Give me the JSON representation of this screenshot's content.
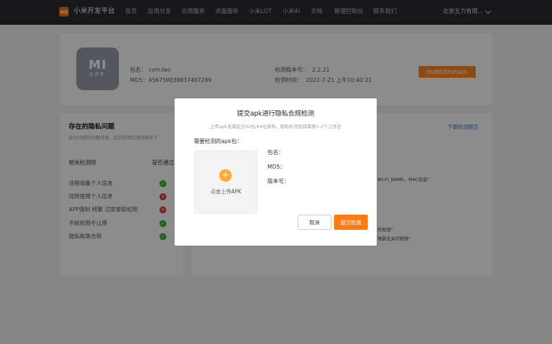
{
  "header": {
    "logo_text": "mi",
    "brand": "小米开发平台",
    "nav": [
      "首页",
      "应用分发",
      "应用服务",
      "流量服务",
      "小米LOT",
      "小米AI",
      "文档",
      "管理控制台",
      "联系我们"
    ],
    "company": "北京五力有限..."
  },
  "app_info": {
    "icon_top": "MI",
    "icon_bottom": "APP",
    "package_label": "包名：",
    "package_value": "com.ten",
    "md5_label": "MD5：",
    "md5_value": "45675WJ39837467289",
    "version_label": "检测版本号：",
    "version_value": "2.2.21",
    "time_label": "检测时间：",
    "time_value": "2021-7-21 上午10:40:21",
    "action_button": "检测修改后的apk"
  },
  "privacy": {
    "title": "存在的隐私问题",
    "subtitle": "经过详细的问题排查，您的应用检测结果如下",
    "col_item": "相关检测项",
    "col_pass": "是否通过",
    "download_link": "下载检测报告",
    "items": [
      {
        "label": "违规收集个人信息",
        "status": "ok"
      },
      {
        "label": "违规使用个人信息",
        "status": "bad"
      },
      {
        "label": "APP强制 频繁 过度索取权限",
        "status": "bad"
      },
      {
        "label": "不给权限不让用",
        "status": "ok"
      },
      {
        "label": "隐私政策合规",
        "status": "ok"
      }
    ],
    "detail_1": "WI-FI_NAME，MAC信息\"",
    "detail_2": "的权限\"",
    "detail_3": "场景无关的权限\""
  },
  "modal": {
    "title": "提交apk进行隐私合规检测",
    "subtitle": "上传apk无需区分32位/64位架构，隐私检测完成需要1-2个工作日",
    "upload_label": "需要检测的apk包：",
    "upload_text": "点击上传APK",
    "package_label": "包名：",
    "md5_label": "MD5：",
    "version_label": "版本号：",
    "cancel": "取消",
    "submit": "提交检测"
  },
  "colors": {
    "accent": "#ff7a12",
    "header_bg": "#2a2d34",
    "ok": "#2eb82e",
    "bad": "#e23a2c"
  }
}
